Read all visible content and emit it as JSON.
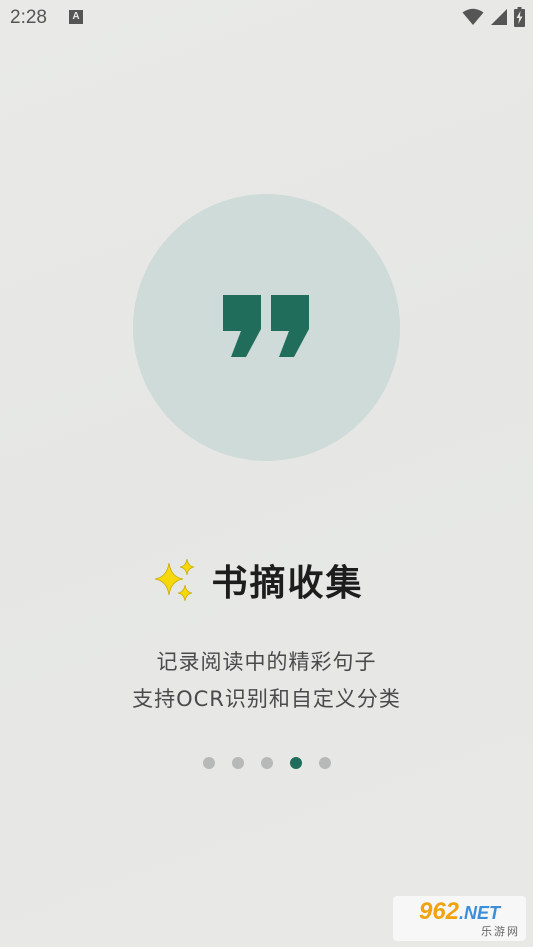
{
  "status_bar": {
    "time": "2:28",
    "notification_icon": "a-letter-icon",
    "notification_letter": "A",
    "icons": [
      "wifi-icon",
      "cellular-signal-icon",
      "battery-charging-icon"
    ]
  },
  "onboarding": {
    "hero_icon": "quote-marks-icon",
    "title_icon": "sparkles-icon",
    "title": "书摘收集",
    "description_line1": "记录阅读中的精彩句子",
    "description_line2": "支持OCR识别和自定义分类",
    "pager": {
      "total": 5,
      "current": 4
    }
  },
  "watermark": {
    "brand": "962",
    "brand_suffix": ".NET",
    "subtitle": "乐游网"
  },
  "colors": {
    "accent": "#1f6d5a",
    "circle": "#cfdbd8",
    "dot_inactive": "#b6b9b8",
    "background": "#e7e8e6"
  }
}
